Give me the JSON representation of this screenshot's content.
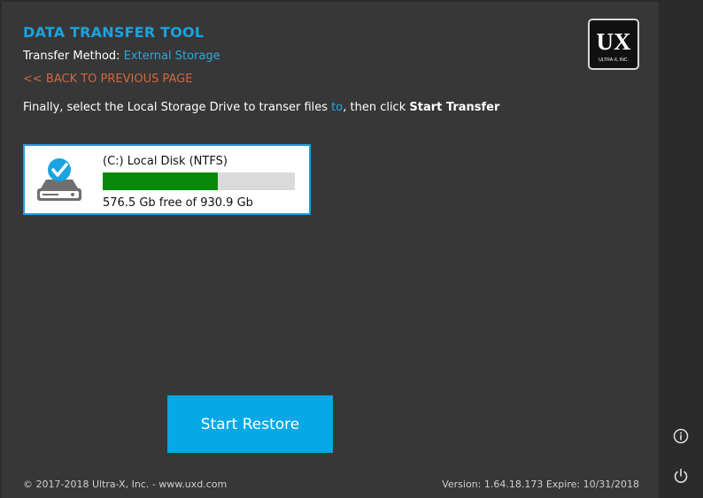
{
  "app": {
    "title": "DATA TRANSFER TOOL",
    "logo_text": "UX",
    "logo_sub": "ULTRA-X, INC."
  },
  "transfer": {
    "label": "Transfer Method: ",
    "value": "External Storage"
  },
  "nav": {
    "back_label": "<< BACK TO PREVIOUS PAGE"
  },
  "instruction": {
    "part1": "Finally, select the Local Storage Drive to transer files ",
    "part2": "to",
    "part3": ", then click ",
    "part4": "Start Transfer"
  },
  "drive": {
    "name": "(C:) Local Disk (NTFS)",
    "free_text": "576.5 Gb free of 930.9 Gb",
    "used_fraction": 0.6,
    "selected": true
  },
  "actions": {
    "start_label": "Start Restore"
  },
  "footer": {
    "copyright": "© 2017-2018 Ultra-X, Inc. - www.uxd.com",
    "version": "Version: 1.64.18.173 Expire: 10/31/2018"
  },
  "side": {
    "icons": [
      "info-icon",
      "power-icon"
    ]
  },
  "colors": {
    "accent": "#1aa3df",
    "back_link": "#d0683f",
    "bar_fill": "#0a8a0a",
    "button": "#06a8e6"
  }
}
